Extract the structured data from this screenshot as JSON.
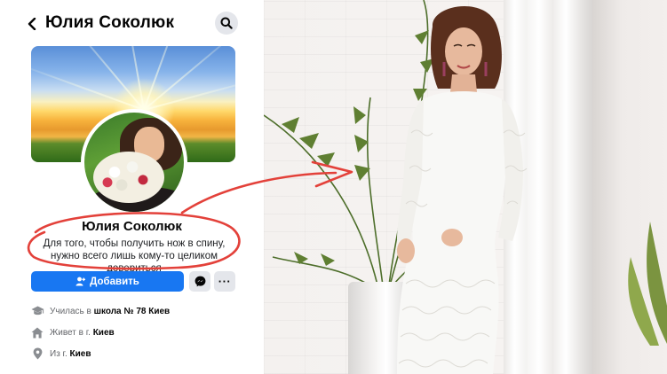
{
  "header": {
    "title": "Юлия Соколюк"
  },
  "profile": {
    "name": "Юлия Соколюк",
    "bio": "Для того, чтобы получить нож в спину, нужно всего лишь кому-то целиком довериться"
  },
  "actions": {
    "add_label": "Добавить"
  },
  "info": {
    "school_prefix": "Училась в",
    "school_value": "школа № 78 Киев",
    "lives_prefix": "Живет в г.",
    "lives_value": "Киев",
    "from_prefix": "Из г.",
    "from_value": "Киев"
  },
  "icons": {
    "back": "chevron-left-icon",
    "search": "search-icon",
    "add_friend": "person-add-icon",
    "messenger": "messenger-icon",
    "more": "more-dots-icon",
    "school": "graduation-cap-icon",
    "home": "house-icon",
    "location": "location-pin-icon"
  },
  "colors": {
    "primary_button": "#1877f2",
    "secondary_button": "#e4e6eb",
    "annotation": "#e3413a",
    "muted_text": "#65676b"
  }
}
